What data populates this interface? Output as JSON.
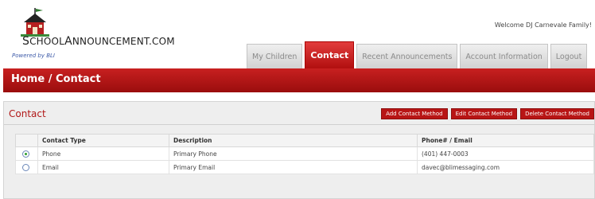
{
  "header": {
    "logo_text_big": "S",
    "logo_text_rest": "CHOOL",
    "logo_text_big2": "A",
    "logo_text_rest2": "NNOUNCEMENT.COM",
    "powered_by": "Powered by BLI",
    "welcome": "Welcome DJ Carnevale Family!"
  },
  "tabs": [
    {
      "label": "My Children",
      "active": false
    },
    {
      "label": "Contact",
      "active": true
    },
    {
      "label": "Recent Announcements",
      "active": false
    },
    {
      "label": "Account Information",
      "active": false
    },
    {
      "label": "Logout",
      "active": false
    }
  ],
  "breadcrumb": "Home / Contact",
  "panel": {
    "title": "Contact",
    "buttons": {
      "add": "Add Contact Method",
      "edit": "Edit Contact Method",
      "delete": "Delete Contact Method"
    }
  },
  "table": {
    "columns": [
      "Contact Type",
      "Description",
      "Phone# / Email"
    ],
    "rows": [
      {
        "selected": true,
        "type": "Phone",
        "description": "Primary Phone",
        "value": "(401) 447-0003"
      },
      {
        "selected": false,
        "type": "Email",
        "description": "Primary Email",
        "value": "davec@blimessaging.com"
      }
    ]
  },
  "colors": {
    "brand_red": "#b81515",
    "link_blue": "#3d5aa8"
  }
}
